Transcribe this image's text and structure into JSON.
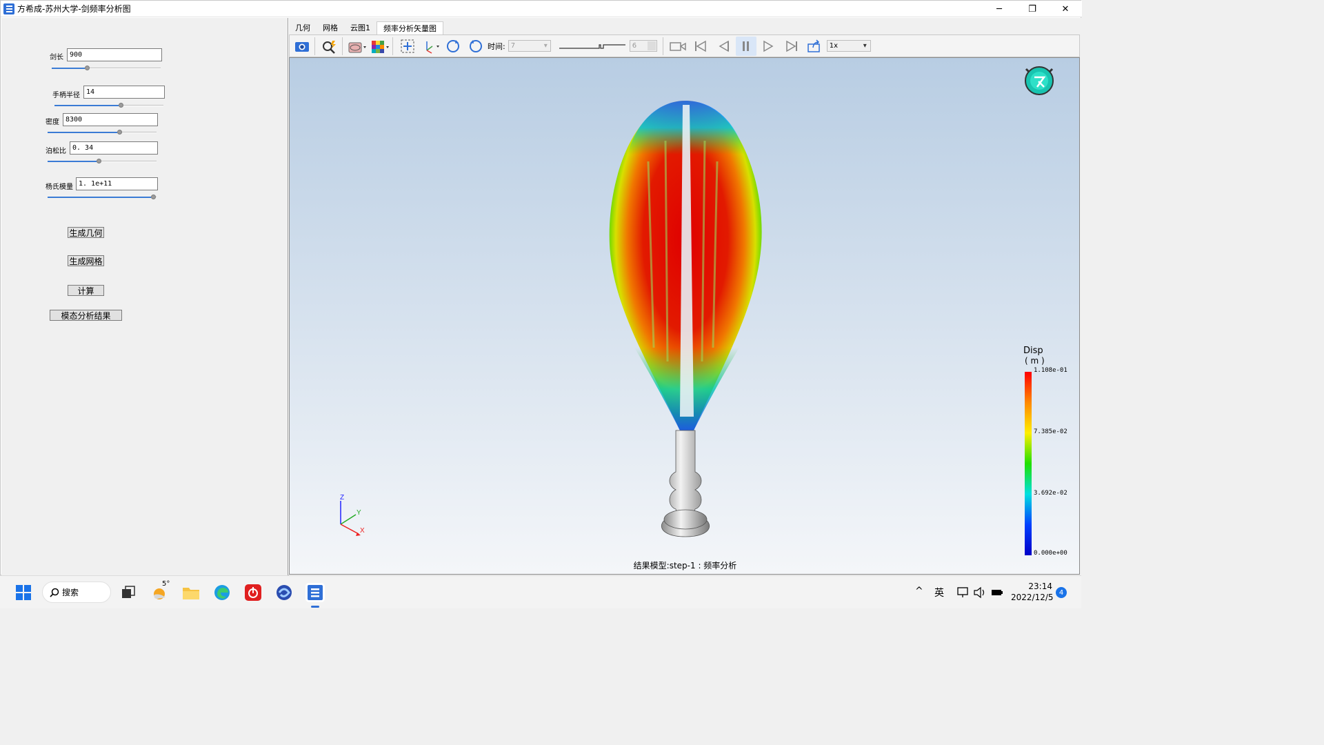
{
  "window": {
    "title": "方希成-苏州大学-剑频率分析图",
    "controls": [
      "─",
      "❐",
      "✕"
    ]
  },
  "params": [
    {
      "label": "剑长",
      "value": "900",
      "slider_fraction": 0.32
    },
    {
      "label": "手柄半径",
      "value": "14",
      "slider_fraction": 0.62
    },
    {
      "label": "密度",
      "value": "8300",
      "slider_fraction": 0.67
    },
    {
      "label": "泊松比",
      "value": "0. 34",
      "slider_fraction": 0.47
    },
    {
      "label": "杨氏模量",
      "value": "1. 1e+11",
      "slider_fraction": 1.0
    }
  ],
  "buttons": {
    "gen_geometry": "生成几何",
    "gen_mesh": "生成网格",
    "compute": "计算",
    "modal_result": "模态分析结果"
  },
  "tabs": [
    "几何",
    "网格",
    "云图1",
    "频率分析矢量图"
  ],
  "active_tab": 3,
  "toolbar": {
    "time_label": "时间:",
    "time_value": "7",
    "frame_value": "6",
    "speed_value": "1x"
  },
  "viewport": {
    "result_caption": "结果模型:step-1 : 频率分析",
    "legend": {
      "title": "Disp",
      "unit": "( m )",
      "ticks": [
        "1.108e-01",
        "7.385e-02",
        "3.692e-02",
        "0.000e+00"
      ]
    },
    "axes": {
      "z": "Z",
      "y": "Y",
      "x": "X"
    }
  },
  "taskbar": {
    "search_label": "搜索",
    "weather": "5°",
    "ime": "英",
    "time": "23:14",
    "date": "2022/12/5",
    "notification_count": "4",
    "tray_chevron": "^"
  },
  "colors": {
    "accent": "#2f6fd6",
    "viewport_top": "#b8cde3",
    "viewport_bottom": "#f4f6f9"
  }
}
